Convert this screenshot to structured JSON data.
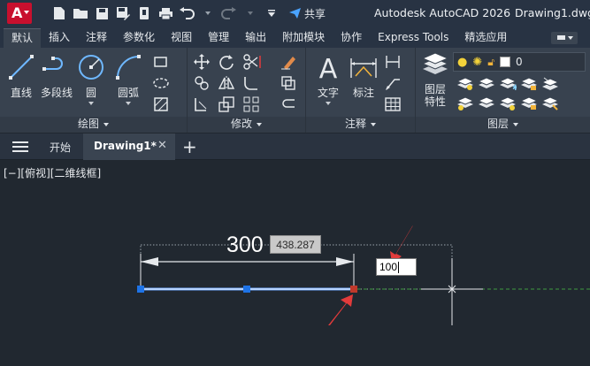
{
  "app": {
    "logo_letter": "A",
    "title": "Autodesk AutoCAD 2026",
    "file": "Drawing1.dwg",
    "share_label": "共享"
  },
  "ribbon_tabs": [
    "默认",
    "插入",
    "注释",
    "参数化",
    "视图",
    "管理",
    "输出",
    "附加模块",
    "协作",
    "Express Tools",
    "精选应用"
  ],
  "active_tab": "默认",
  "panels": {
    "draw": {
      "title": "绘图",
      "tools": {
        "line": "直线",
        "polyline": "多段线",
        "circle": "圆",
        "arc": "圆弧"
      }
    },
    "modify": {
      "title": "修改"
    },
    "annotation": {
      "title": "注释",
      "tools": {
        "text": "文字",
        "dimension": "标注"
      }
    },
    "layers": {
      "title": "图层",
      "properties_line1": "图层",
      "properties_line2": "特性",
      "current_layer": "0"
    }
  },
  "file_tabs": {
    "start": "开始",
    "active": "Drawing1*"
  },
  "viewport_label": "[−][俯视][二维线框]",
  "drawing": {
    "dimension_value": "300",
    "tooltip_length": "438.287",
    "dynamic_input": "100"
  },
  "colors": {
    "canvas": "#212830",
    "selected_line": "#6ea8ff",
    "grip": "#1e73e6",
    "grip_hot": "#c0392b",
    "arrow": "#e23b3b",
    "tracking": "#3f9a3f"
  }
}
